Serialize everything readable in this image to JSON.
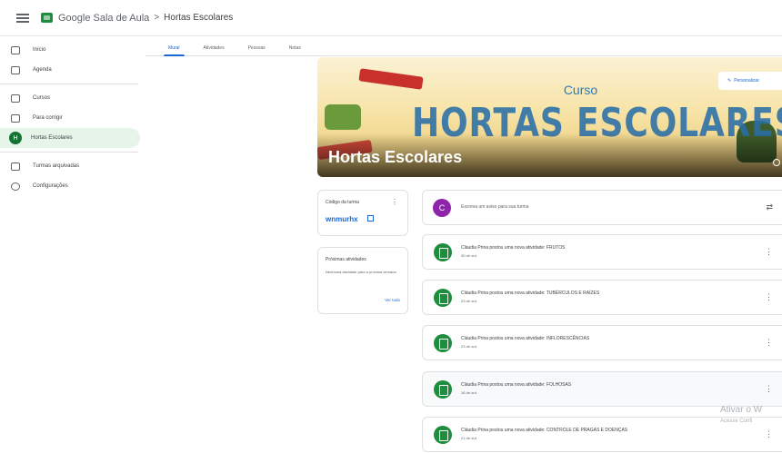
{
  "header": {
    "app_title": "Google Sala de Aula",
    "separator": ">",
    "breadcrumb": "Hortas Escolares"
  },
  "sidebar": {
    "items": [
      {
        "label": "Início",
        "icon": "home-icon"
      },
      {
        "label": "Agenda",
        "icon": "calendar-icon"
      },
      {
        "label": "Cursos",
        "icon": "people-icon"
      },
      {
        "label": "Para corrigir",
        "icon": "folder-icon"
      },
      {
        "label": "Hortas Escolares",
        "icon": "class-avatar",
        "initial": "H"
      },
      {
        "label": "Turmas arquivadas",
        "icon": "archive-icon"
      },
      {
        "label": "Configurações",
        "icon": "gear-icon"
      }
    ]
  },
  "tabs": [
    "Mural",
    "Atividades",
    "Pessoas",
    "Notas"
  ],
  "banner": {
    "curso": "Curso",
    "big_title": "HORTAS ESCOLARES",
    "title": "Hortas Escolares",
    "personalize_label": "Personalizar"
  },
  "class_code": {
    "label": "Código da turma",
    "value": "wnmurhx"
  },
  "upcoming": {
    "title": "Próximas atividades",
    "text": "Nenhuma atividade para a próxima semana",
    "link": "Ver tudo"
  },
  "announce": {
    "avatar_initial": "C",
    "placeholder": "Escreva um aviso para sua turma"
  },
  "posts": [
    {
      "text": "Cláudia Prina postou uma nova atividade: FRUTOS",
      "date": "30 de out."
    },
    {
      "text": "Cláudia Prina postou uma nova atividade: TUBÉRCULOS E RAÍZES",
      "date": "23 de out."
    },
    {
      "text": "Cláudia Prina postou uma nova atividade: INFLORESCÊNCIAS",
      "date": "23 de out."
    },
    {
      "text": "Cláudia Prina postou uma nova atividade: FOLHOSAS",
      "date": "16 de out."
    },
    {
      "text": "Cláudia Prina postou uma nova atividade: CONTROLE DE PRAGAS E DOENÇAS",
      "date": "21 de out."
    }
  ],
  "watermark": {
    "line1": "Ativar o W",
    "line2": "Acesse Confi"
  },
  "colors": {
    "accent": "#1967d2",
    "class_green": "#1e8e3e",
    "avatar_purple": "#8e24aa",
    "active_nav_bg": "#e6f4ea"
  }
}
